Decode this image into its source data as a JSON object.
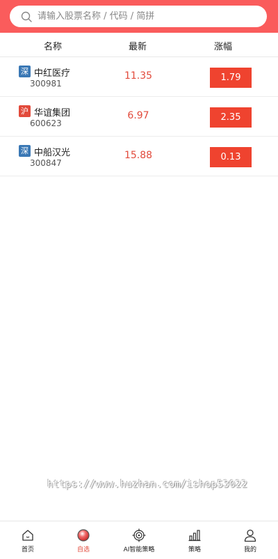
{
  "search": {
    "placeholder": "请输入股票名称 / 代码 / 简拼",
    "icon": "search-icon"
  },
  "table_header": {
    "name": "名称",
    "price": "最新",
    "change": "涨幅"
  },
  "stocks": [
    {
      "market": "深",
      "name": "中红医疗",
      "code": "300981",
      "price": "11.35",
      "change": "1.79"
    },
    {
      "market": "沪",
      "name": "华谊集团",
      "code": "600623",
      "price": "6.97",
      "change": "2.35"
    },
    {
      "market": "深",
      "name": "中船汉光",
      "code": "300847",
      "price": "15.88",
      "change": "0.13"
    }
  ],
  "watermark": "https://www.huzhan.com/ishop53022",
  "tabs": [
    {
      "label": "首页",
      "icon": "home-icon"
    },
    {
      "label": "自选",
      "icon": "watchlist-icon",
      "active": true
    },
    {
      "label": "AI智能策略",
      "icon": "target-icon"
    },
    {
      "label": "策略",
      "icon": "chart-bars-icon"
    },
    {
      "label": "我的",
      "icon": "user-icon"
    }
  ],
  "colors": {
    "brand": "#fa5c5c",
    "up": "#e24a3b",
    "change_bg": "#ef432f",
    "shenzhen_badge": "#3a78b5",
    "shanghai_badge": "#e24a3b"
  }
}
